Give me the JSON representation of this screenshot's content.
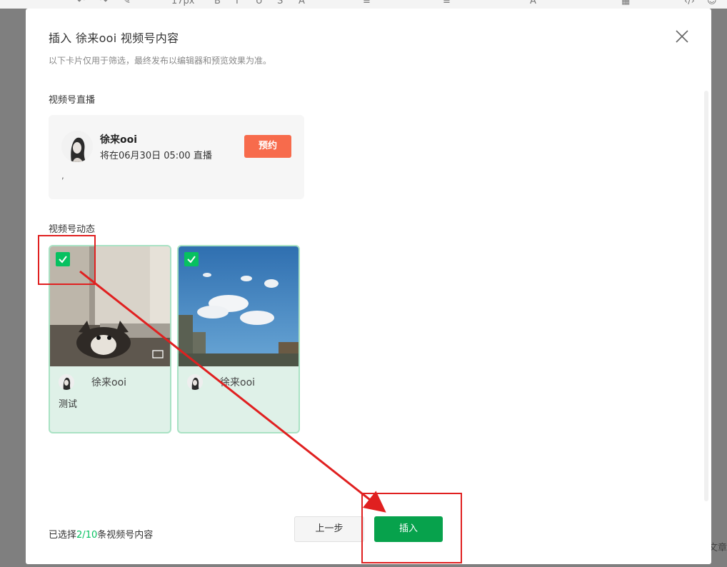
{
  "modal": {
    "title": "插入 徐来ooi 视频号内容",
    "subtitle": "以下卡片仅用于筛选，最终发布以编辑器和预览效果为准。"
  },
  "live_section": {
    "label": "视频号直播",
    "card": {
      "name": "徐来ooi",
      "time": "将在06月30日 05:00 直播",
      "extra": ",",
      "reserve_label": "预约"
    }
  },
  "posts_section": {
    "label": "视频号动态",
    "posts": [
      {
        "author": "徐来ooi",
        "desc": "测试",
        "checked": true
      },
      {
        "author": "徐来ooi",
        "desc": "",
        "checked": true
      }
    ]
  },
  "footer": {
    "count_prefix": "已选择",
    "count_selected": "2",
    "count_sep": "/",
    "count_total": "10",
    "count_suffix": "条视频号内容",
    "prev_label": "上一步",
    "insert_label": "插入"
  },
  "background": {
    "font_size": "17px",
    "right_text": "文章"
  },
  "colors": {
    "accent": "#07c160",
    "insert_button": "#07a24c",
    "reserve_button": "#f76b4c",
    "annotation": "#e02020"
  }
}
